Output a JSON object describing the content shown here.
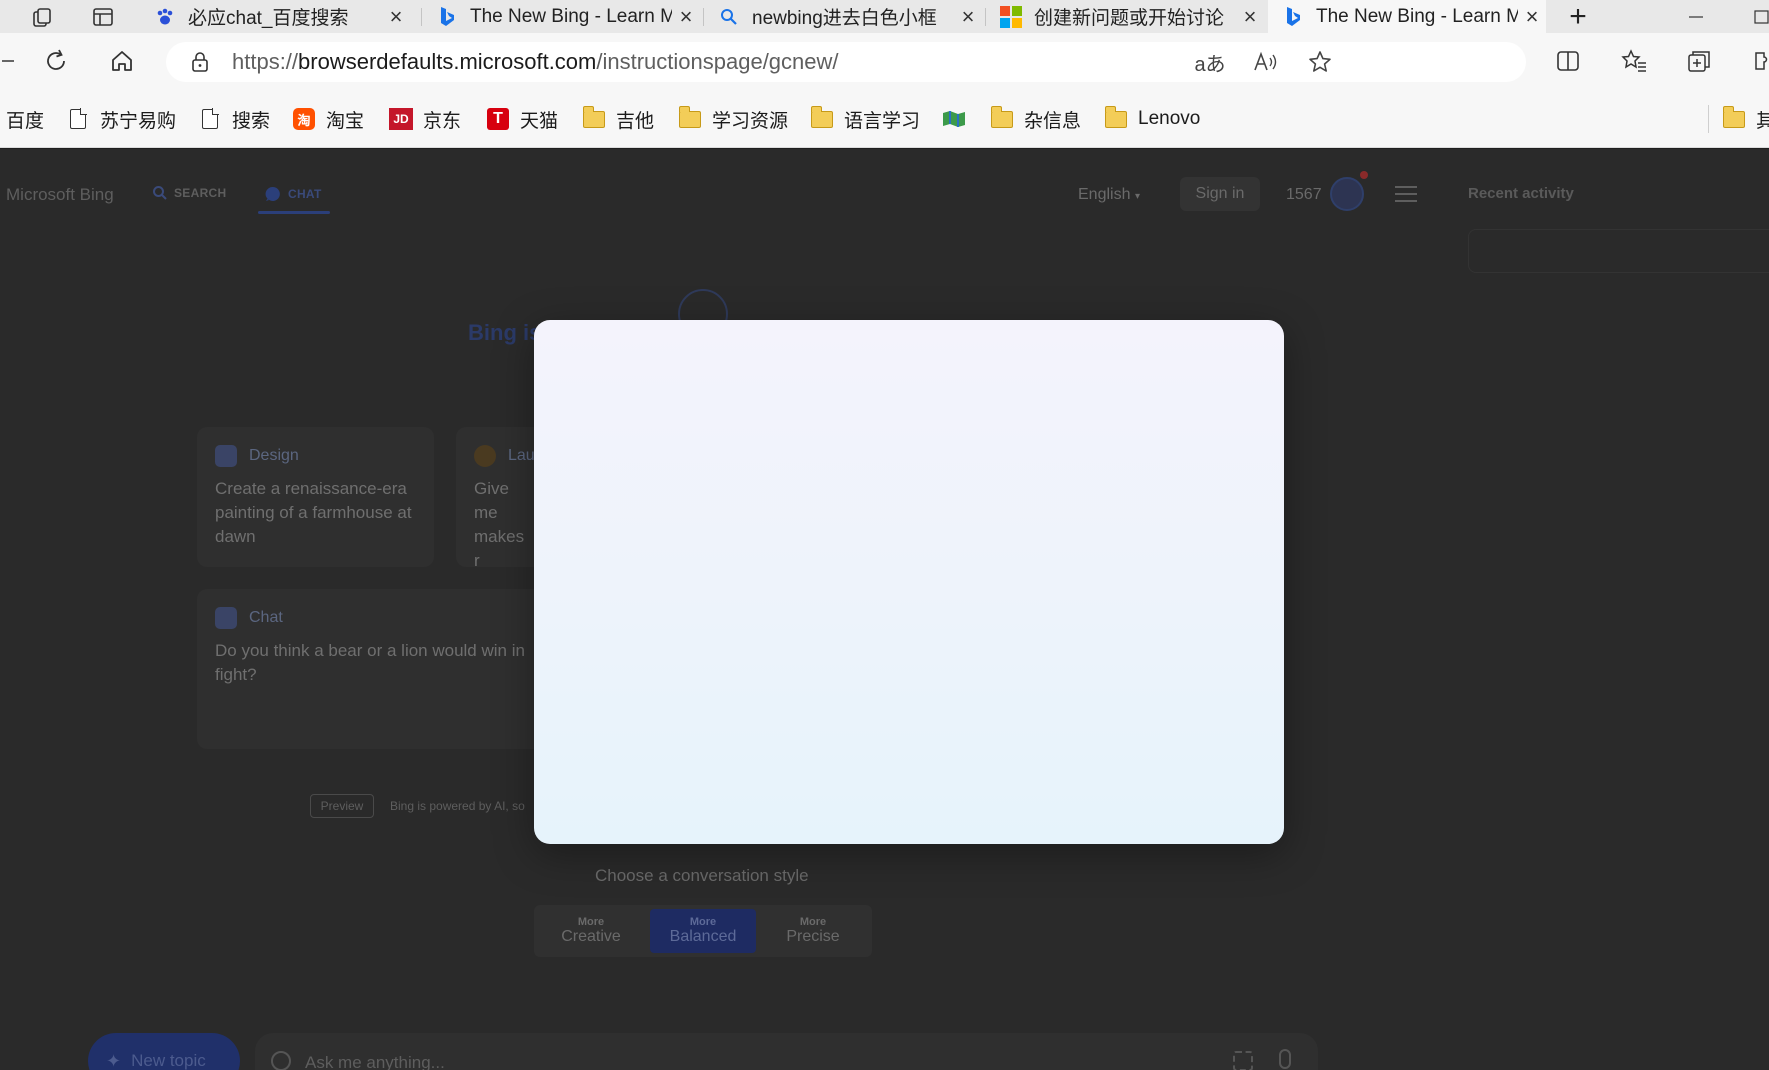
{
  "browser": {
    "tabs": [
      {
        "label": "必应chat_百度搜索",
        "icon": "baidu-paw-icon",
        "active": false
      },
      {
        "label": "The New Bing - Learn M",
        "icon": "bing-icon",
        "active": false
      },
      {
        "label": "newbing进去白色小框",
        "icon": "search-icon",
        "active": false
      },
      {
        "label": "创建新问题或开始讨论",
        "icon": "microsoft-icon",
        "active": false
      },
      {
        "label": "The New Bing - Learn M",
        "icon": "bing-icon",
        "active": true
      }
    ],
    "new_tab_symbol": "+",
    "address": {
      "scheme": "https://",
      "host": "browserdefaults.microsoft.com",
      "path": "/instructionspage/gcnew/",
      "read_aloud_symbol": "A",
      "translate_symbol": "aあ"
    },
    "favorites": [
      {
        "label": "百度",
        "icon": "none"
      },
      {
        "label": "苏宁易购",
        "icon": "page-icon"
      },
      {
        "label": "搜索",
        "icon": "page-icon"
      },
      {
        "label": "淘宝",
        "icon": "taobao-icon"
      },
      {
        "label": "京东",
        "icon": "jd-icon"
      },
      {
        "label": "天猫",
        "icon": "tmall-icon"
      },
      {
        "label": "吉他",
        "icon": "folder-icon"
      },
      {
        "label": "学习资源",
        "icon": "folder-icon"
      },
      {
        "label": "语言学习",
        "icon": "folder-icon"
      },
      {
        "label": "",
        "icon": "map-icon"
      },
      {
        "label": "杂信息",
        "icon": "folder-icon"
      },
      {
        "label": "Lenovo",
        "icon": "folder-icon"
      },
      {
        "label": "其",
        "icon": "folder-icon"
      }
    ],
    "favicon_text": {
      "jd": "JD",
      "tmall": "T",
      "taobao": "淘"
    }
  },
  "bing": {
    "brand": "Microsoft Bing",
    "nav": {
      "search": "SEARCH",
      "chat": "CHAT"
    },
    "language": "English",
    "sign_in": "Sign in",
    "points": "1567",
    "recent_activity": "Recent activity",
    "title_fragment": "Bing is",
    "cards": [
      {
        "category": "Design",
        "text": "Create a renaissance-era painting of a farmhouse at dawn"
      },
      {
        "category": "Lau",
        "text": "Give me makes r"
      },
      {
        "category": "Chat",
        "text": "Do you think a bear or a lion would win in fight?"
      }
    ],
    "preview_badge": "Preview",
    "powered_text": "Bing is powered by AI, so",
    "style_label": "Choose a conversation style",
    "styles": [
      {
        "small": "More",
        "large": "Creative",
        "selected": false
      },
      {
        "small": "More",
        "large": "Balanced",
        "selected": true
      },
      {
        "small": "More",
        "large": "Precise",
        "selected": false
      }
    ],
    "new_topic": "New topic",
    "ask_placeholder": "Ask me anything..."
  },
  "colors": {
    "overlay": "#2a2a2a",
    "accent": "#1e2b62",
    "modal_top": "#f4f3fc",
    "modal_bottom": "#e6f3fb"
  }
}
